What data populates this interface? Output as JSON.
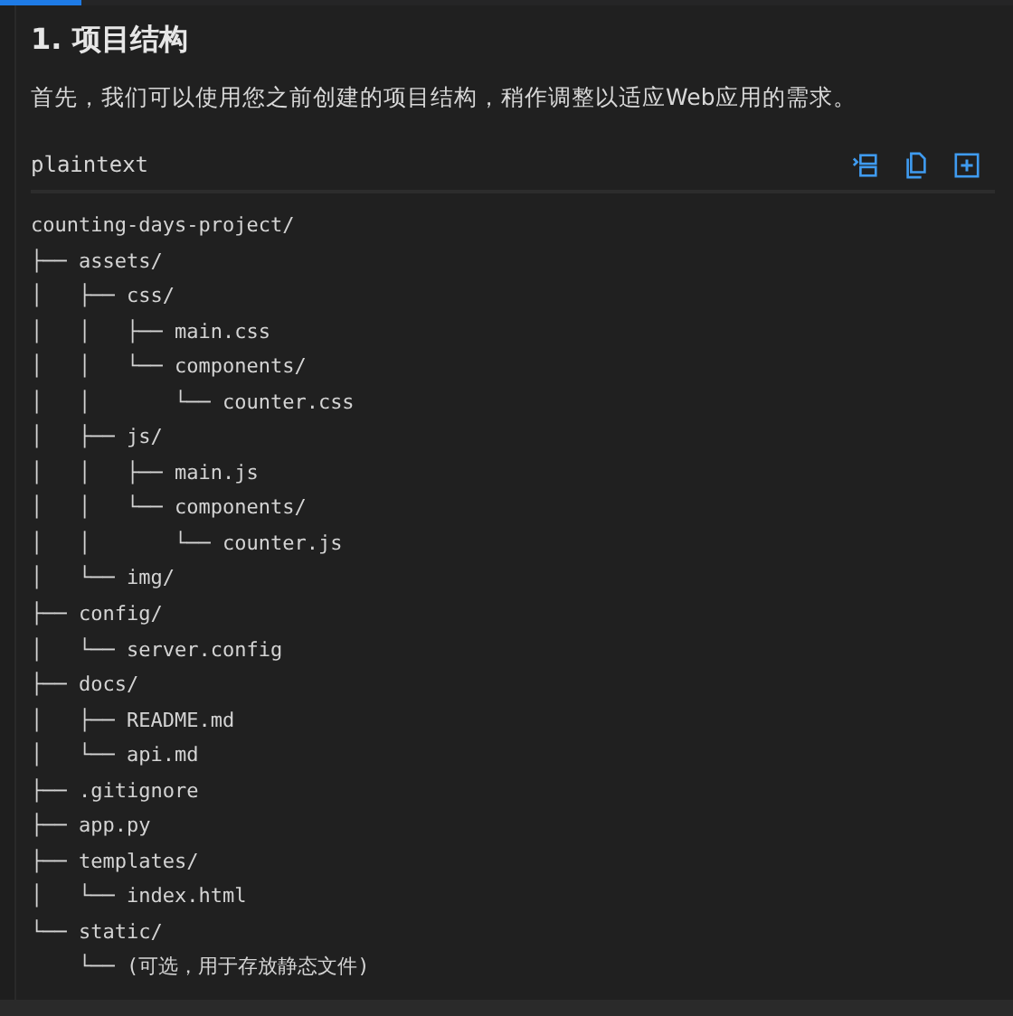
{
  "heading": "1. 项目结构",
  "intro": "首先，我们可以使用您之前创建的项目结构，稍作调整以适应Web应用的需求。",
  "code_block": {
    "language": "plaintext",
    "lines": [
      "counting-days-project/",
      "├── assets/",
      "│   ├── css/",
      "│   │   ├── main.css",
      "│   │   └── components/",
      "│   │       └── counter.css",
      "│   ├── js/",
      "│   │   ├── main.js",
      "│   │   └── components/",
      "│   │       └── counter.js",
      "│   └── img/",
      "├── config/",
      "│   └── server.config",
      "├── docs/",
      "│   ├── README.md",
      "│   └── api.md",
      "├── .gitignore",
      "├── app.py",
      "├── templates/",
      "│   └── index.html",
      "└── static/",
      "    └── (可选，用于存放静态文件)"
    ]
  }
}
